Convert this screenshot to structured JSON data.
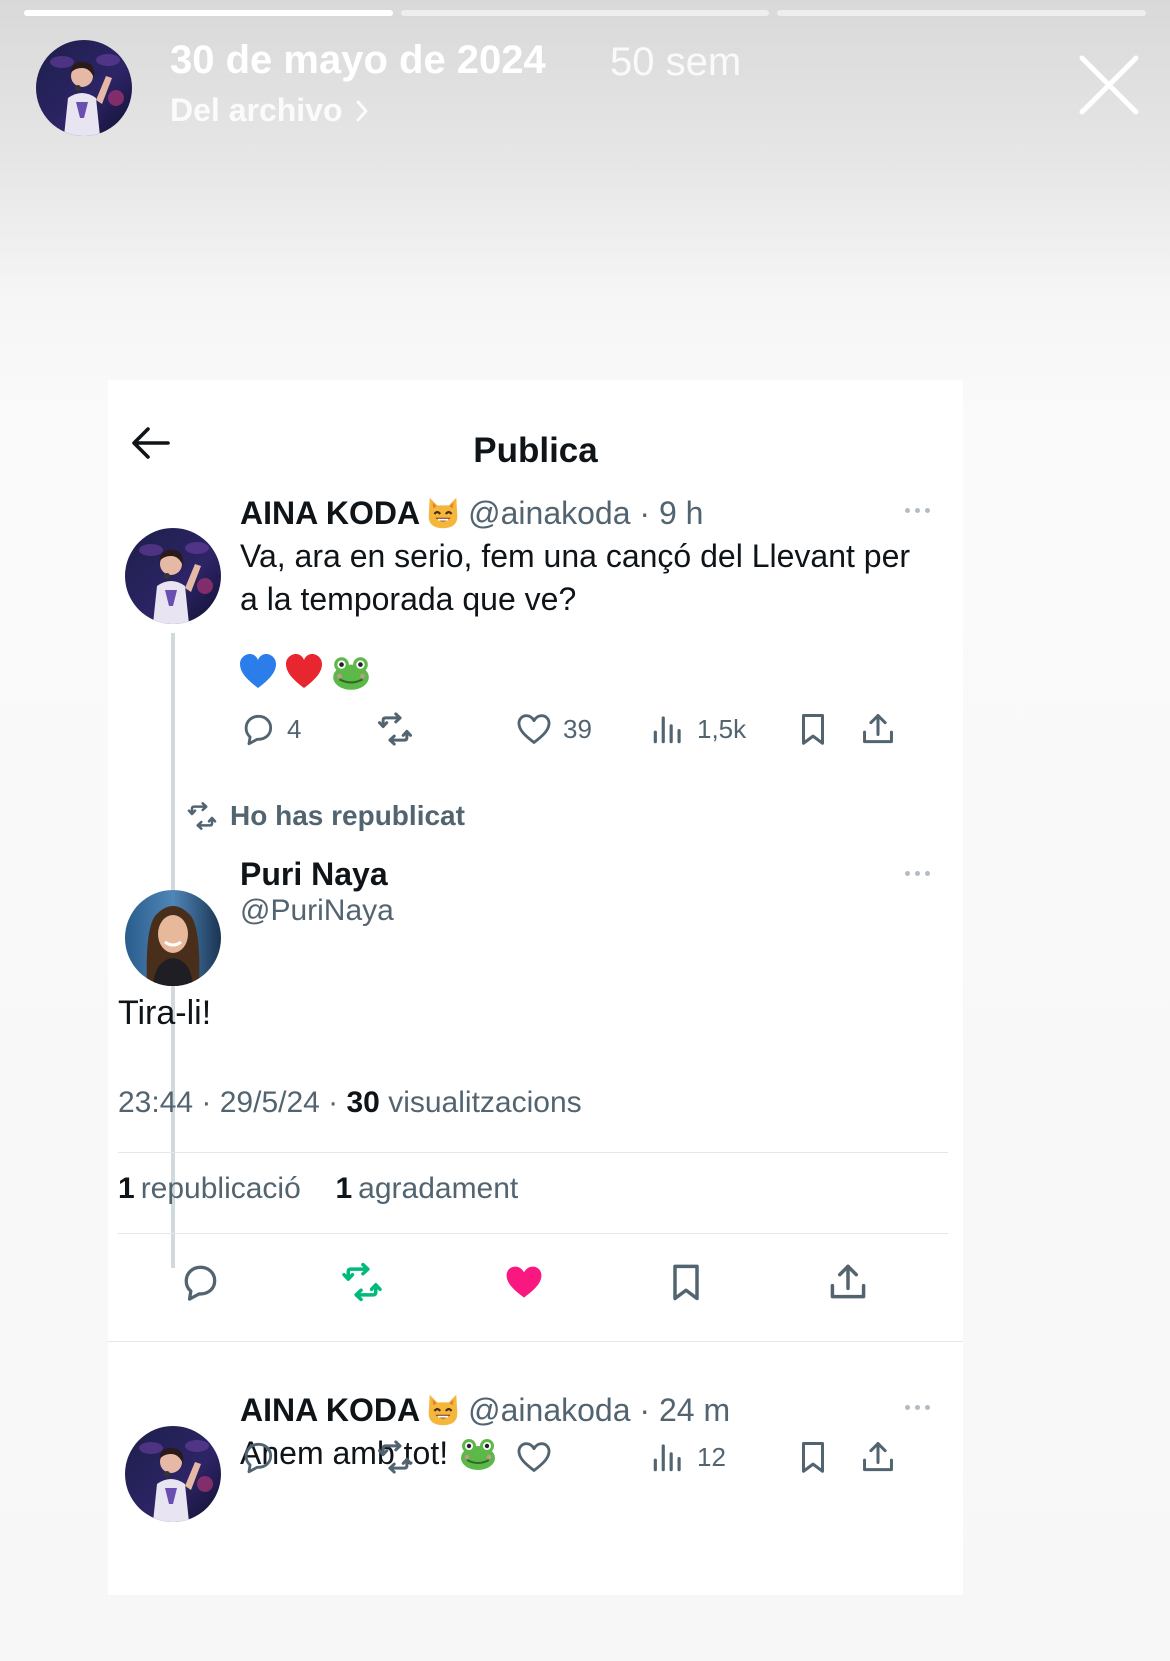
{
  "story": {
    "progress": [
      1,
      0,
      0
    ],
    "date": "30 de mayo de 2024",
    "age": "50 sem",
    "archive_label": "Del archivo",
    "close_icon": "close-icon"
  },
  "header": {
    "back_icon": "arrow-left-icon",
    "title": "Publica"
  },
  "parent_tweet": {
    "author": "AINA KODA",
    "author_emoji": "grinning-cat-emoji",
    "handle": "@ainakoda",
    "time": "9 h",
    "text_line1": "Va, ara en serio, fem una cançó del Llevant per",
    "text_line2": "a la temporada que ve?",
    "emojis": [
      "blue-heart-emoji",
      "red-heart-emoji",
      "frog-emoji"
    ],
    "replies": "4",
    "likes": "39",
    "views": "1,5k"
  },
  "repost_notice": "Ho has republicat",
  "main_tweet": {
    "author": "Puri Naya",
    "handle": "@PuriNaya",
    "text": "Tira-li!",
    "timestamp": "23:44 · 29/5/24 · ",
    "views_count": "30",
    "views_label": " visualitzacions",
    "reposts_count": "1",
    "reposts_label": "republicació",
    "likes_count": "1",
    "likes_label": "agradament",
    "colors": {
      "repost_active": "#00ba7c",
      "like_active": "#f91880"
    }
  },
  "reply_tweet": {
    "author": "AINA KODA",
    "author_emoji": "grinning-cat-emoji",
    "handle": "@ainakoda",
    "time": "24 m",
    "text": "Anem amb tot!",
    "text_emoji": "frog-emoji",
    "views": "12"
  }
}
